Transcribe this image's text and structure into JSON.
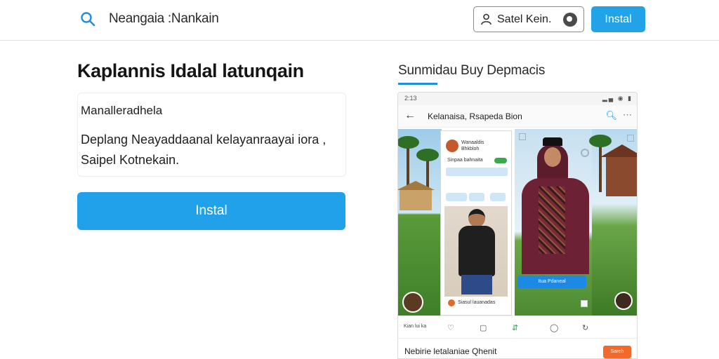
{
  "header": {
    "brand": "Neangaia :Nankain",
    "account_label": "Satel Kein.",
    "install_label": "Instal"
  },
  "main": {
    "title": "Kaplannis Idalal latunqain",
    "description": {
      "heading": "Manalleradhela",
      "line1": "Deplang Neayaddaanal kelayanraayai iora ,",
      "line2": "Saipel Kotnekain."
    },
    "install_label": "Instal"
  },
  "screenshots": {
    "title": "Sunmidau Buy Depmacis",
    "phone": {
      "status_time": "2:13",
      "status_icons": "▂▄ ◉ ▮",
      "appbar_title": "Kelanaisa, Rsapeda Bion",
      "card_user": "Wanaaldis Bhkbloh",
      "card_message": "Sinpaa bahnaita",
      "card_footer": "Siasul lauanadas",
      "cta_label": "Itua Pdaneal",
      "nav_label": "Kian lui ka",
      "strip_text": "Nebirie letalaniae Qhenit",
      "strip_button": "Sareh"
    }
  },
  "colors": {
    "accent": "#22a3e8",
    "orange": "#f26a2b",
    "green": "#21a44a"
  }
}
